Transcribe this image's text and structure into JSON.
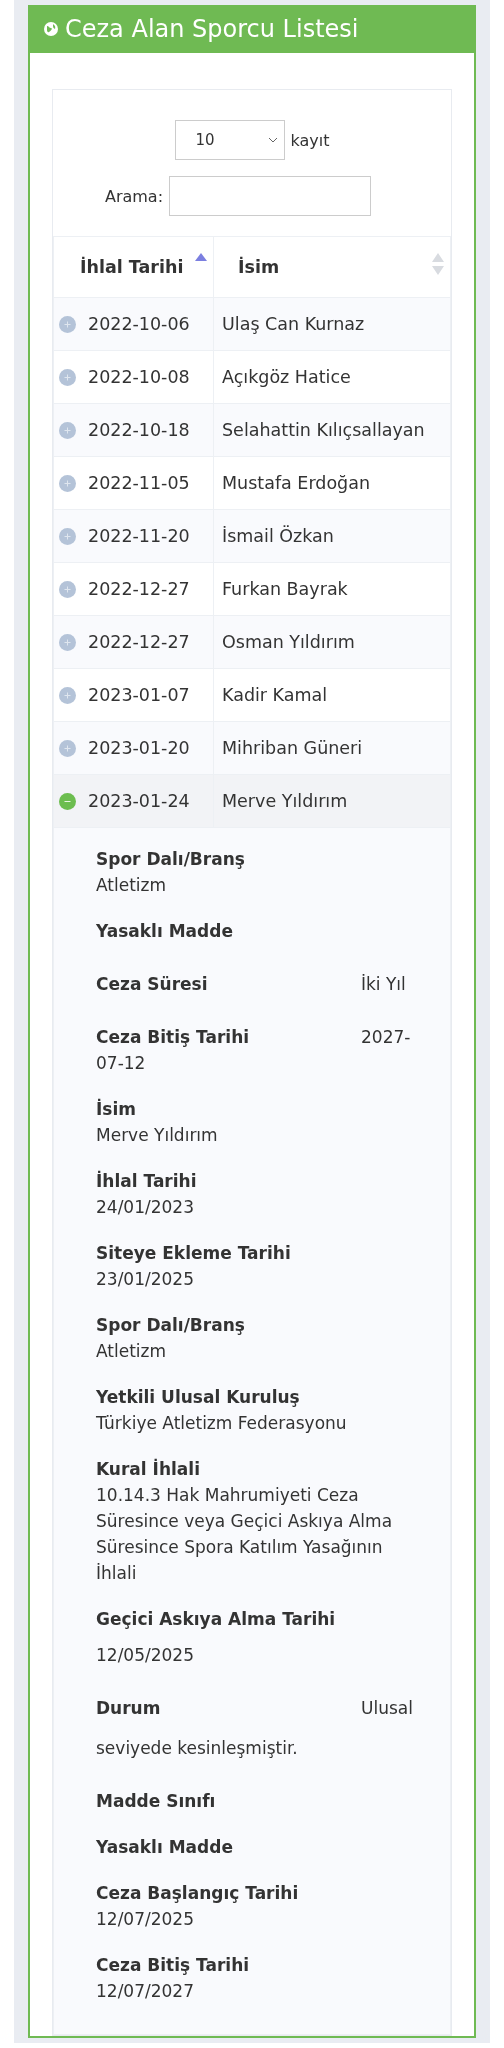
{
  "panel": {
    "title": "Ceza Alan Sporcu Listesi"
  },
  "length": {
    "value": "10",
    "suffix": "kayıt"
  },
  "search": {
    "label": "Arama:"
  },
  "table": {
    "columns": [
      {
        "label": "İhlal Tarihi",
        "sorted": true
      },
      {
        "label": "İsim",
        "sorted": false
      }
    ],
    "rows": [
      {
        "date": "2022-10-06",
        "name": "Ulaş Can Kurnaz",
        "expanded": false
      },
      {
        "date": "2022-10-08",
        "name": "Açıkgöz Hatice",
        "expanded": false
      },
      {
        "date": "2022-10-18",
        "name": "Selahattin Kılıçsallayan",
        "expanded": false
      },
      {
        "date": "2022-11-05",
        "name": "Mustafa Erdoğan",
        "expanded": false
      },
      {
        "date": "2022-11-20",
        "name": "İsmail Özkan",
        "expanded": false
      },
      {
        "date": "2022-12-27",
        "name": "Furkan Bayrak",
        "expanded": false
      },
      {
        "date": "2022-12-27",
        "name": "Osman Yıldırım",
        "expanded": false
      },
      {
        "date": "2023-01-07",
        "name": "Kadir Kamal",
        "expanded": false
      },
      {
        "date": "2023-01-20",
        "name": "Mihriban Güneri",
        "expanded": false
      },
      {
        "date": "2023-01-24",
        "name": "Merve Yıldırım",
        "expanded": true
      }
    ]
  },
  "details": [
    {
      "kind": "stacked",
      "label": "Spor Dalı/Branş",
      "value": "Atletizm"
    },
    {
      "kind": "stacked",
      "label": "Yasaklı Madde"
    },
    {
      "kind": "inline",
      "label": "Ceza Süresi",
      "value": "İki Yıl"
    },
    {
      "kind": "inline",
      "label": "Ceza Bitiş Tarihi",
      "value": "2027-07-12"
    },
    {
      "kind": "stacked",
      "label": "İsim",
      "value": "Merve Yıldırım"
    },
    {
      "kind": "stacked",
      "label": "İhlal Tarihi",
      "value": "24/01/2023"
    },
    {
      "kind": "stacked",
      "label": "Siteye Ekleme Tarihi",
      "value": "23/01/2025"
    },
    {
      "kind": "stacked",
      "label": "Spor Dalı/Branş",
      "value": "Atletizm"
    },
    {
      "kind": "stacked",
      "label": "Yetkili Ulusal Kuruluş",
      "value": "Türkiye Atletizm Federasyonu"
    },
    {
      "kind": "stacked",
      "label": "Kural İhlali",
      "value": "10.14.3 Hak Mahrumiyeti Ceza Süresince veya Geçici Askıya Alma Süresince Spora Katılım Yasağının İhlali"
    },
    {
      "kind": "spaced",
      "label": "Geçici Askıya Alma Tarihi",
      "value": "12/05/2025"
    },
    {
      "kind": "inline",
      "label": "Durum",
      "value": "Ulusal seviyede kesinleşmiştir."
    },
    {
      "kind": "stacked",
      "label": "Madde Sınıfı"
    },
    {
      "kind": "stacked",
      "label": "Yasaklı Madde"
    },
    {
      "kind": "stacked",
      "label": "Ceza Başlangıç Tarihi",
      "value": "12/07/2025"
    },
    {
      "kind": "stacked",
      "label": "Ceza Bitiş Tarihi",
      "value": "12/07/2027"
    }
  ]
}
